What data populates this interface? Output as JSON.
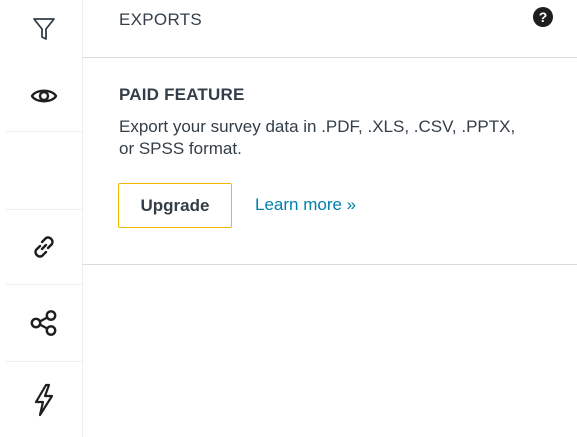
{
  "header": {
    "title": "EXPORTS",
    "help_glyph": "?"
  },
  "rail": {
    "icons": [
      "filter-icon",
      "eye-icon",
      "link-icon",
      "share-icon",
      "lightning-icon"
    ]
  },
  "panel": {
    "title": "PAID FEATURE",
    "description": "Export your survey data in .PDF, .XLS, .CSV, .PPTX, or SPSS format.",
    "upgrade_label": "Upgrade",
    "learn_more_label": "Learn more »"
  },
  "colors": {
    "accent_border": "#f2b800",
    "link": "#007faa",
    "text": "#333e48"
  }
}
